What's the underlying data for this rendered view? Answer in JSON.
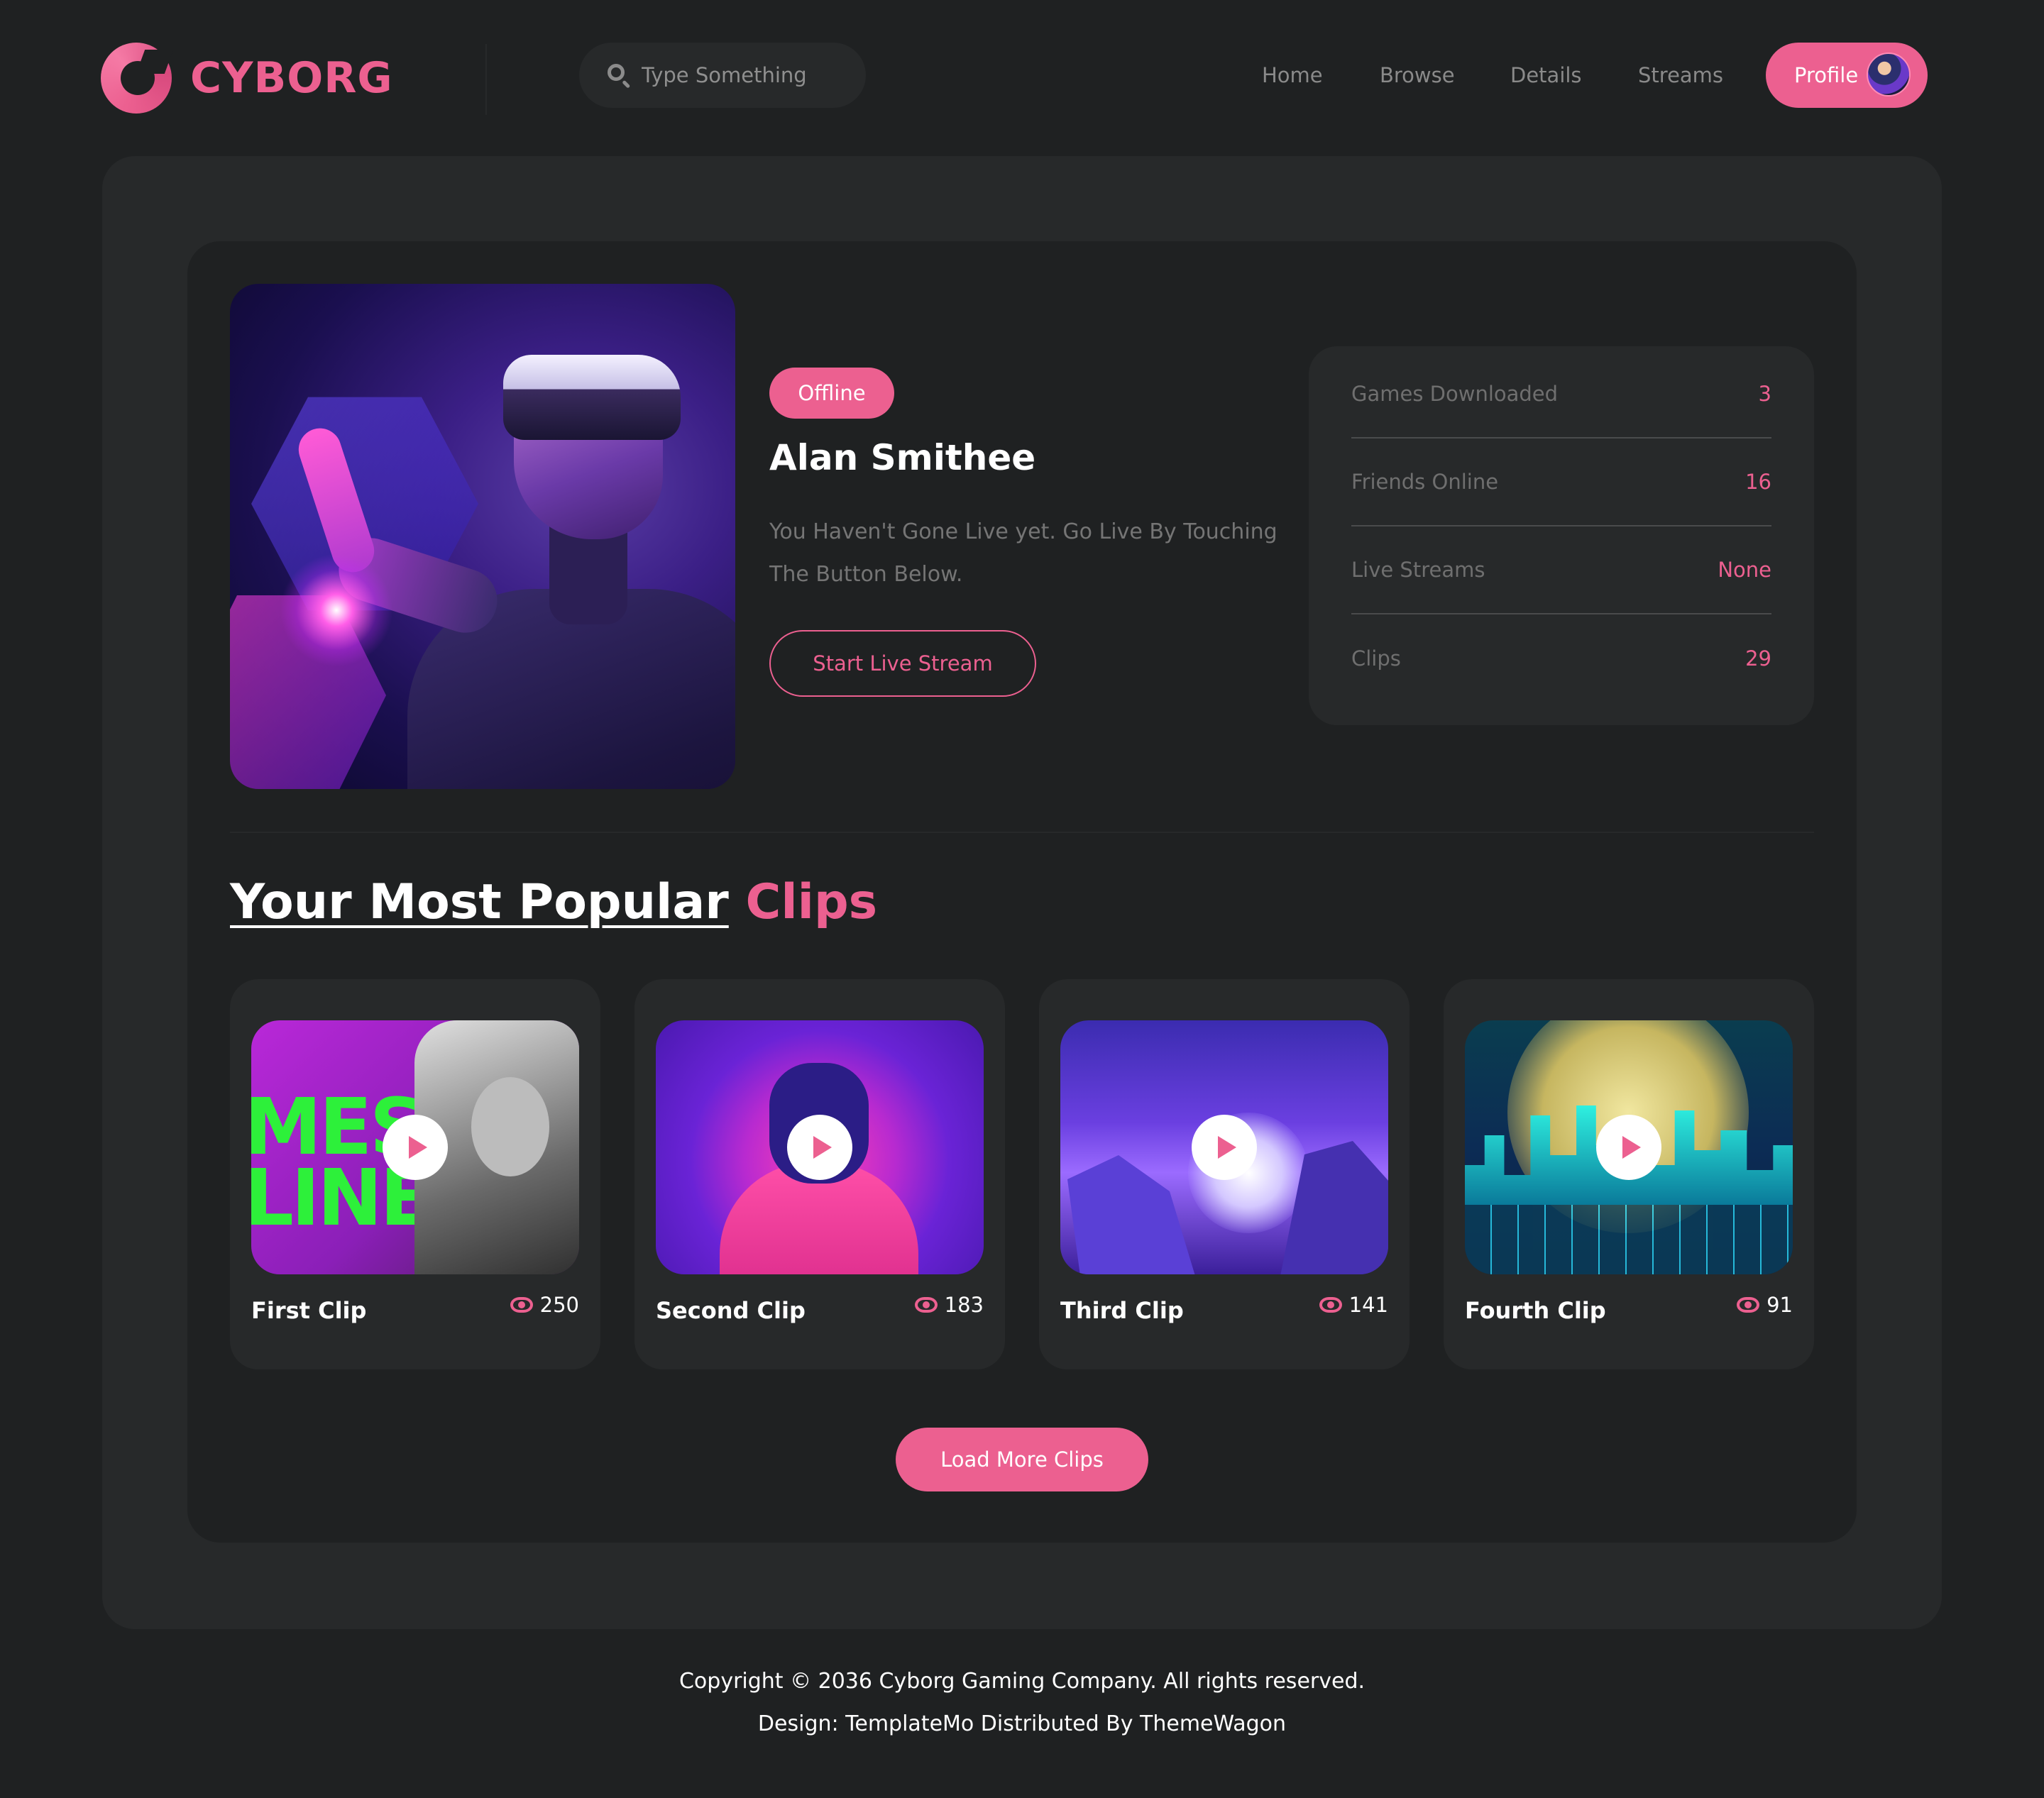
{
  "brand": {
    "name": "CYBORG",
    "accent_color": "#ec6090",
    "logo_icon": "cyborg-logo-icon"
  },
  "search": {
    "placeholder": "Type Something",
    "value": ""
  },
  "nav": {
    "items": [
      {
        "label": "Home"
      },
      {
        "label": "Browse"
      },
      {
        "label": "Details"
      },
      {
        "label": "Streams"
      }
    ],
    "profile_label": "Profile"
  },
  "profile": {
    "status": "Offline",
    "name": "Alan Smithee",
    "description": "You Haven't Gone Live yet. Go Live By Touching The Button Below.",
    "live_button": "Start Live Stream"
  },
  "stats": [
    {
      "label": "Games Downloaded",
      "value": "3"
    },
    {
      "label": "Friends Online",
      "value": "16"
    },
    {
      "label": "Live Streams",
      "value": "None"
    },
    {
      "label": "Clips",
      "value": "29"
    }
  ],
  "clips_section": {
    "heading_main": "Your Most Popular",
    "heading_accent": "Clips",
    "clips": [
      {
        "title": "First Clip",
        "views": "250"
      },
      {
        "title": "Second Clip",
        "views": "183"
      },
      {
        "title": "Third Clip",
        "views": "141"
      },
      {
        "title": "Fourth Clip",
        "views": "91"
      }
    ],
    "load_more": "Load More Clips"
  },
  "footer": {
    "copyright": "Copyright © 2036 Cyborg Gaming Company. All rights reserved.",
    "credit": "Design: TemplateMo Distributed By ThemeWagon"
  }
}
